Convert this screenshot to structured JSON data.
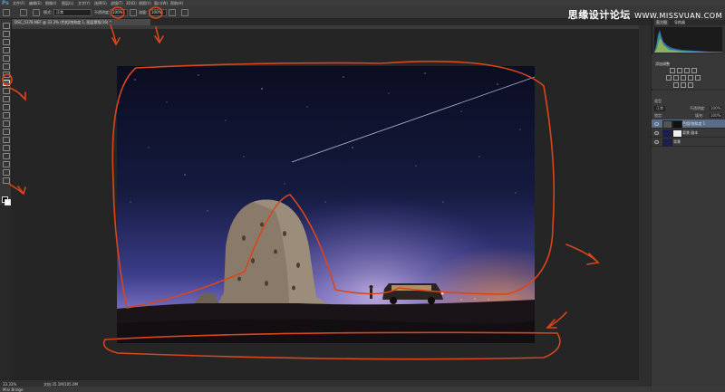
{
  "app": {
    "logo": "Ps"
  },
  "menu": [
    "文件(F)",
    "编辑(E)",
    "图像(I)",
    "图层(L)",
    "文字(Y)",
    "选择(S)",
    "滤镜(T)",
    "3D(D)",
    "视图(V)",
    "窗口(W)",
    "帮助(H)"
  ],
  "watermark": {
    "main": "思缘设计论坛",
    "sub": "WWW.MISSVUAN.COM"
  },
  "options_bar": {
    "mode_label": "模式:",
    "mode_value": "正常",
    "opacity_label": "不透明度:",
    "opacity_value": "100%",
    "flow_label": "流量:",
    "flow_value": "100%"
  },
  "document_tab": {
    "title": "DSC_5378.NEF @ 33.3% (色相/饱和度 1, 图层蒙版/16) *"
  },
  "status_bar": {
    "zoom": "33.33%",
    "doc_info": "文档:35.1M/105.0M"
  },
  "bottom_bar": {
    "label": "Mini Bridge"
  },
  "panels": {
    "histogram_tab": "直方图",
    "navigator_tab": "导航器",
    "adjustments_tab": "调整",
    "adjustments_title": "添加调整",
    "layers_tab": "图层",
    "channels_tab": "通道",
    "paths_tab": "路径",
    "kind_label": "类型",
    "blend_mode": "正常",
    "opacity_label": "不透明度:",
    "opacity_value": "100%",
    "lock_label": "锁定:",
    "fill_label": "填充:",
    "fill_value": "100%",
    "layers": [
      {
        "name": "色相/饱和度 1",
        "selected": true
      },
      {
        "name": "背景 副本",
        "selected": false
      },
      {
        "name": "背景",
        "selected": false
      }
    ]
  },
  "colors": {
    "annotation": "#d9461c",
    "selected_layer": "#5b6e89",
    "sky_top": "#0d0f24",
    "horizon_glow": "#8a7bd8"
  },
  "icons": [
    "brush-icon",
    "lasso-icon",
    "eye-icon",
    "foreground-color-icon",
    "background-color-icon"
  ]
}
